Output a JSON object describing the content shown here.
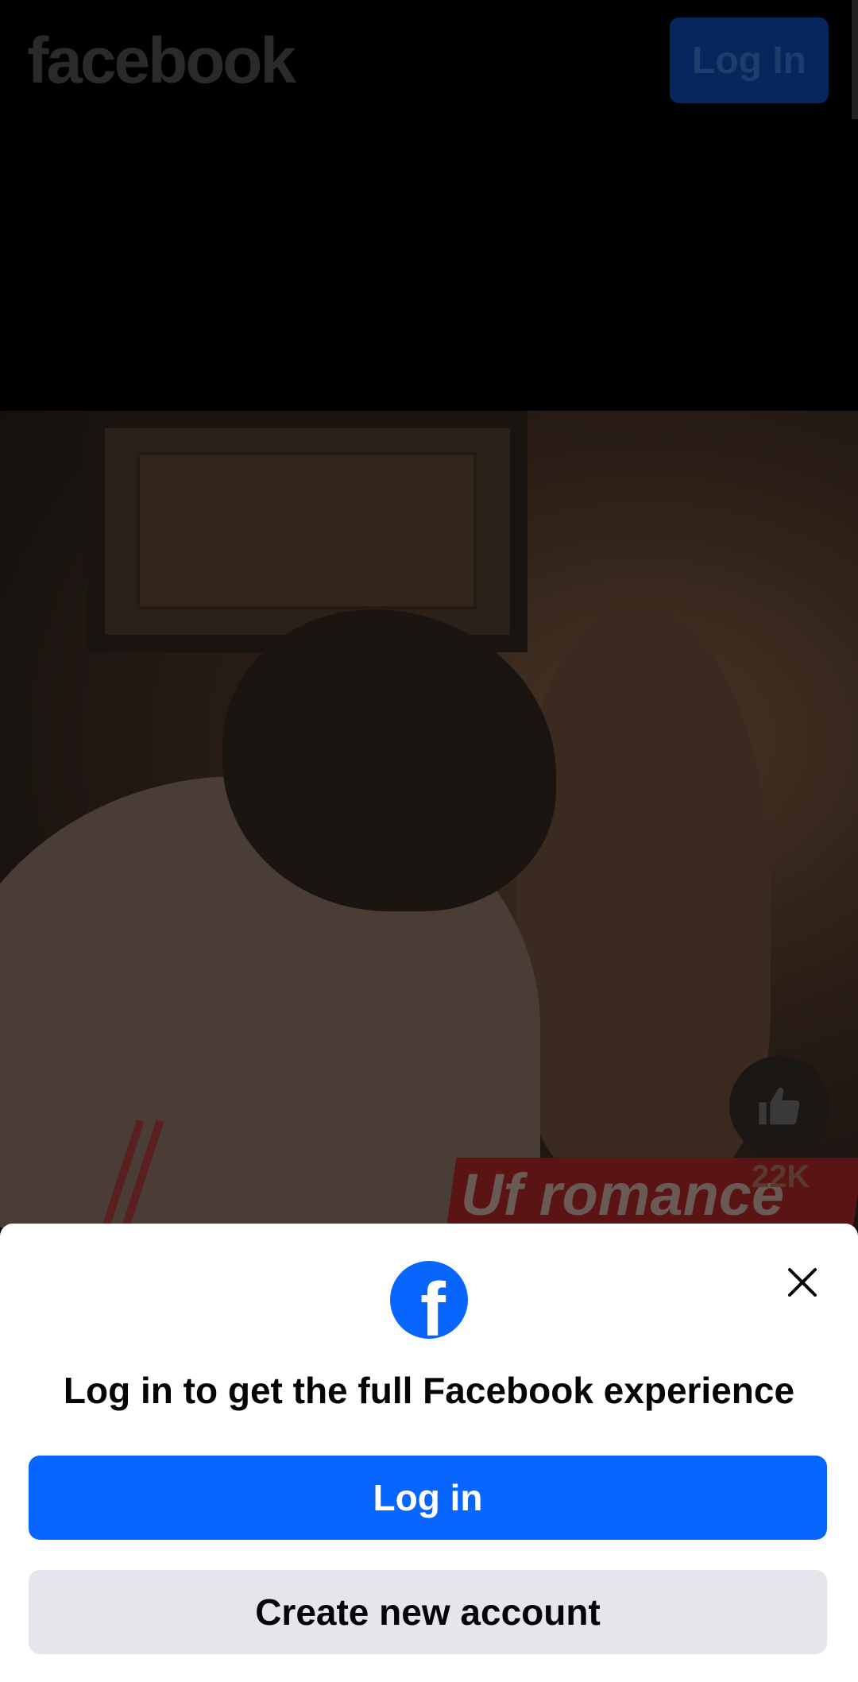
{
  "header": {
    "logo_text": "facebook",
    "login_label": "Log In"
  },
  "video": {
    "like_count": "22K",
    "caption": "Uf romance"
  },
  "sheet": {
    "title": "Log in to get the full Facebook experience",
    "fb_glyph": "f",
    "login_label": "Log in",
    "create_label": "Create new account"
  },
  "colors": {
    "brand_blue": "#0866ff",
    "secondary_gray": "#e4e6eb"
  }
}
